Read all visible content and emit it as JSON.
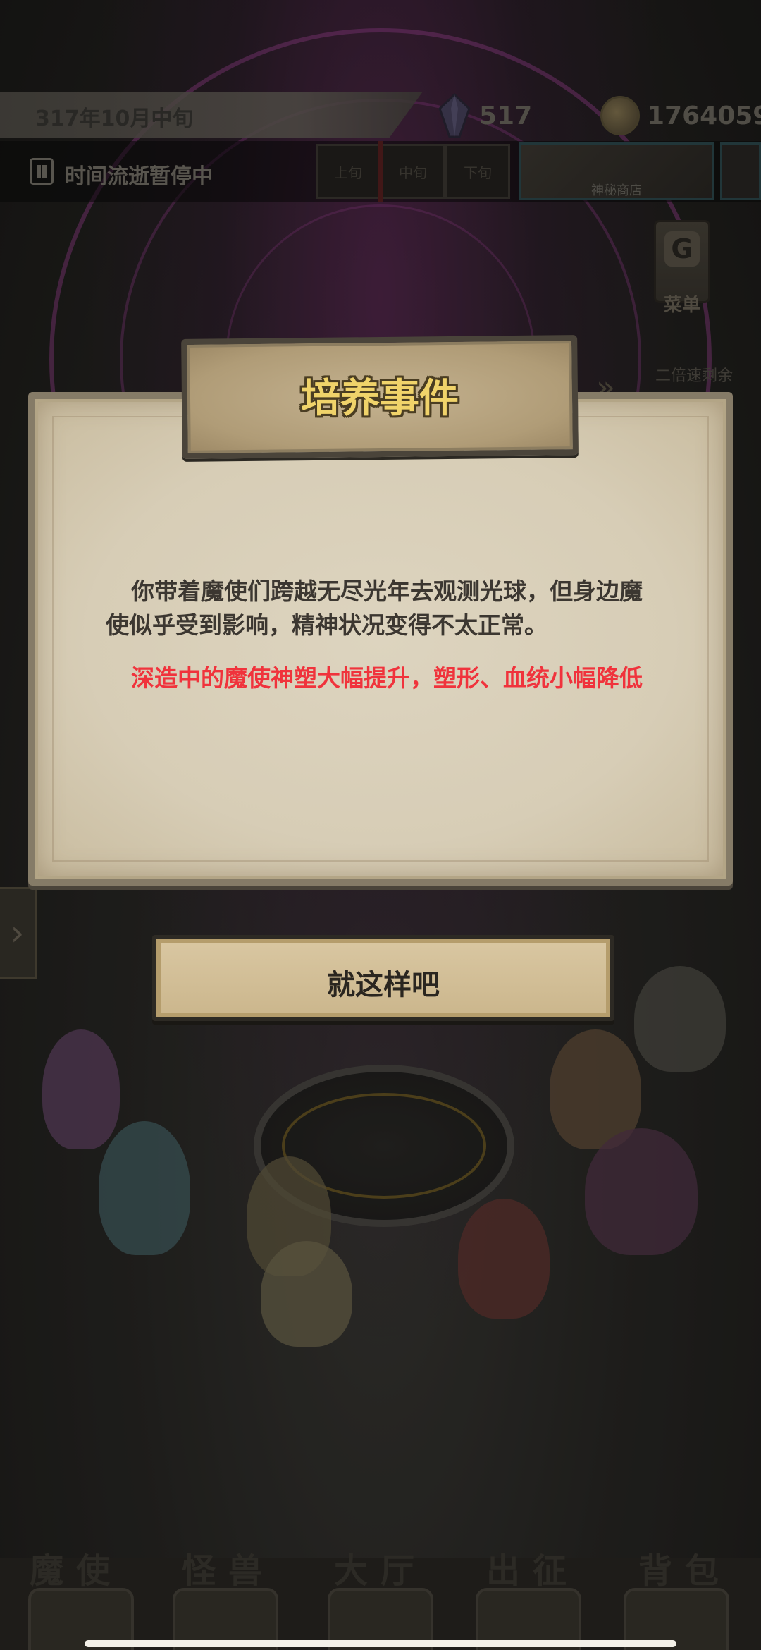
{
  "hud": {
    "date": "317年10月中旬",
    "gems": "517",
    "coins": "1764059",
    "time_status": "时间流逝暂停中",
    "tenday_segments": [
      "上旬",
      "中旬",
      "下旬"
    ],
    "shop_label": "神秘商店",
    "menu_label": "菜单",
    "speed_label": "二倍速剩余"
  },
  "dialog": {
    "title": "培养事件",
    "body": "你带着魔使们跨越无尽光年去观测光球，但身边魔使似乎受到影响，精神状况变得不太正常。",
    "effect": "深造中的魔使神塑大幅提升，塑形、血统小幅降低",
    "confirm_label": "就这样吧"
  },
  "nav": {
    "items": [
      {
        "label": "魔使"
      },
      {
        "label": "怪兽"
      },
      {
        "label": "大厅"
      },
      {
        "label": "出征"
      },
      {
        "label": "背包"
      }
    ]
  },
  "colors": {
    "title_gold": "#f0d36a",
    "effect_red": "#f0333c",
    "parchment": "#ddd4bf"
  }
}
